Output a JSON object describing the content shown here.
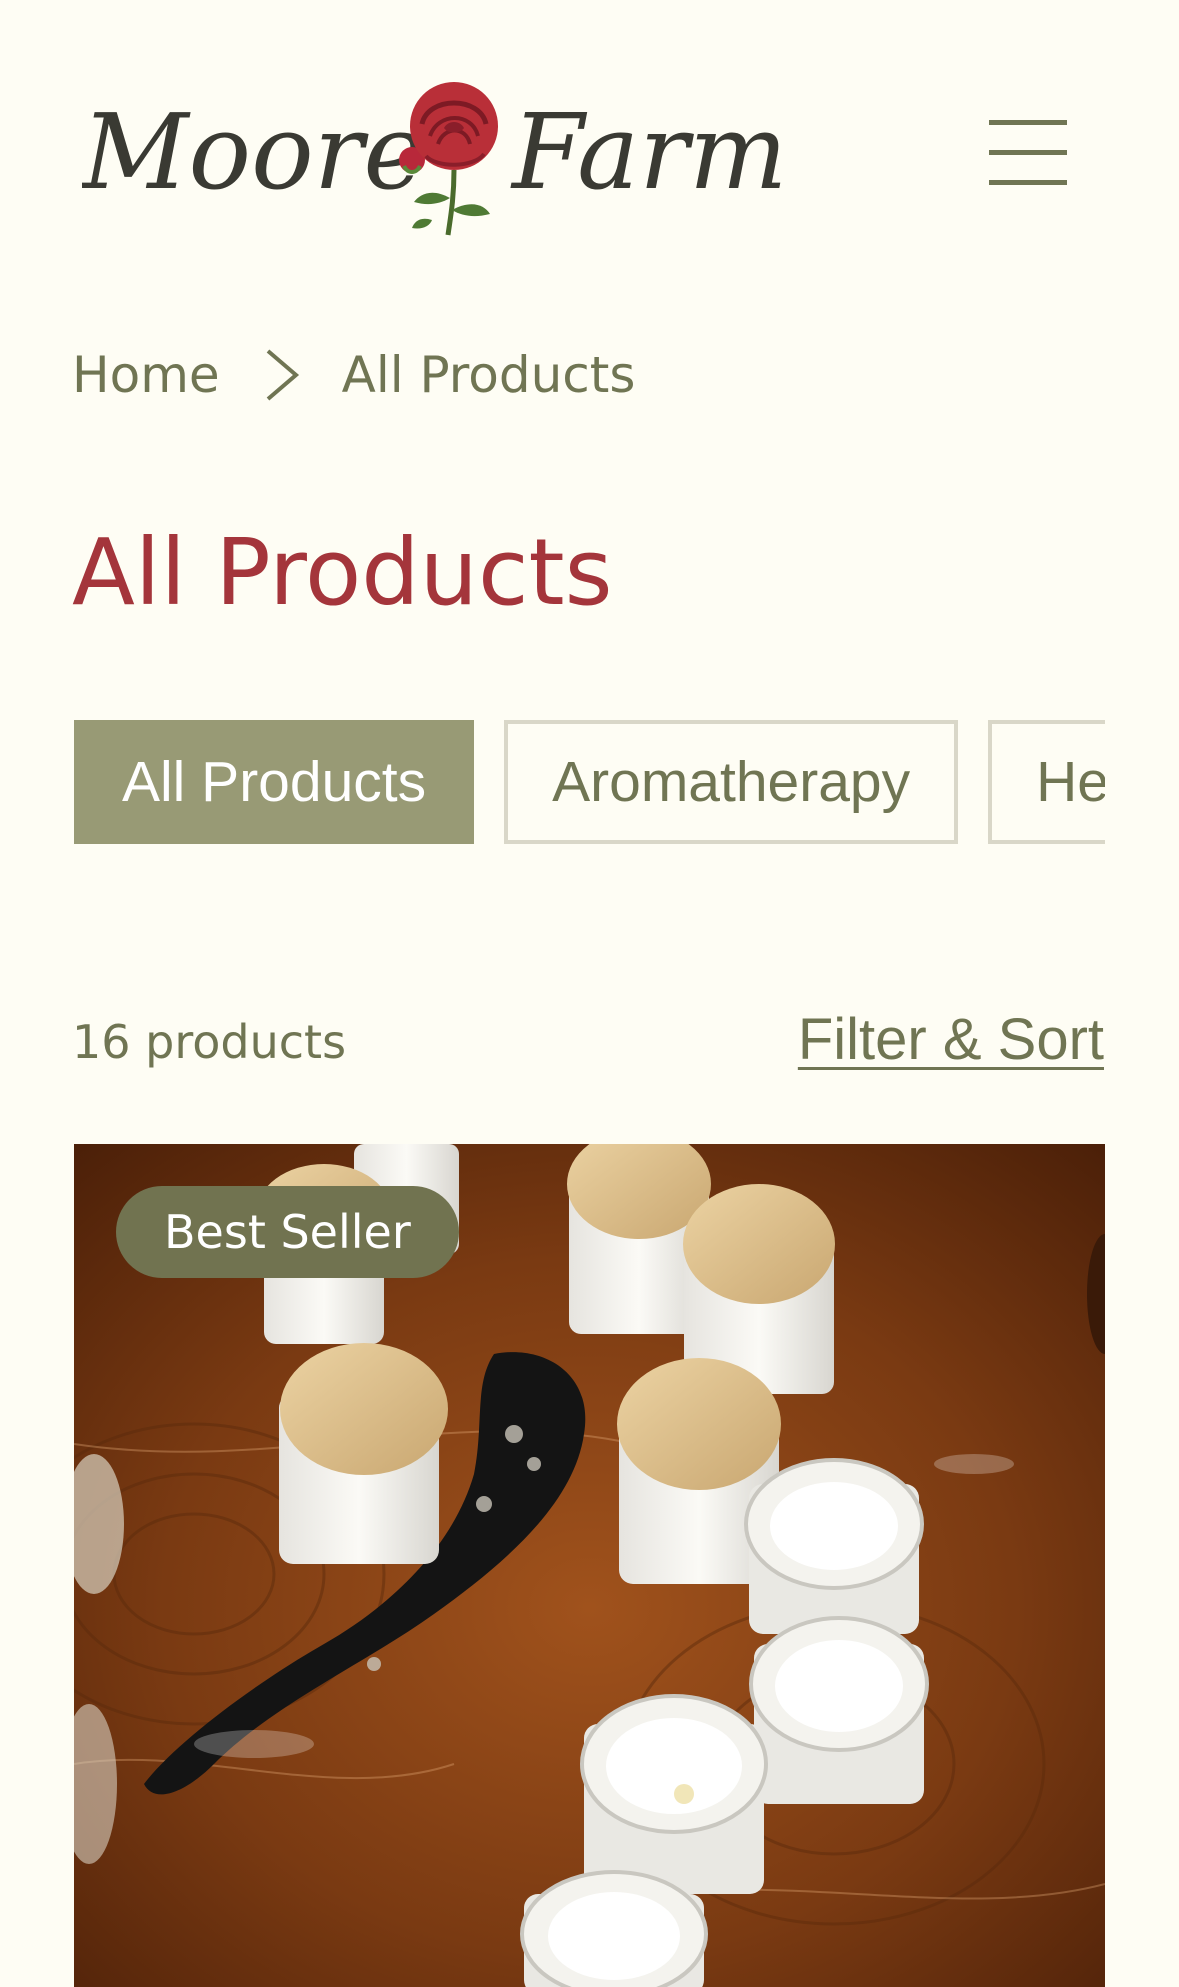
{
  "header": {
    "logo_text_left": "Moore",
    "logo_text_right": "Farm",
    "menu_icon": "hamburger-menu-icon"
  },
  "breadcrumb": {
    "home": "Home",
    "current": "All Products",
    "separator_icon": "chevron-right-icon"
  },
  "page": {
    "title": "All Products"
  },
  "category_tabs": {
    "items": [
      {
        "label": "All Products",
        "active": true
      },
      {
        "label": "Aromatherapy",
        "active": false
      },
      {
        "label": "Herbal",
        "active": false
      }
    ]
  },
  "listing": {
    "count_text": "16 products",
    "filter_sort_label": "Filter & Sort"
  },
  "product": {
    "badge": "Best Seller"
  },
  "colors": {
    "background": "#FEFDF4",
    "accent_olive": "#989A75",
    "badge_olive": "#717350",
    "text_olive": "#707553",
    "title_red": "#A4353B"
  }
}
